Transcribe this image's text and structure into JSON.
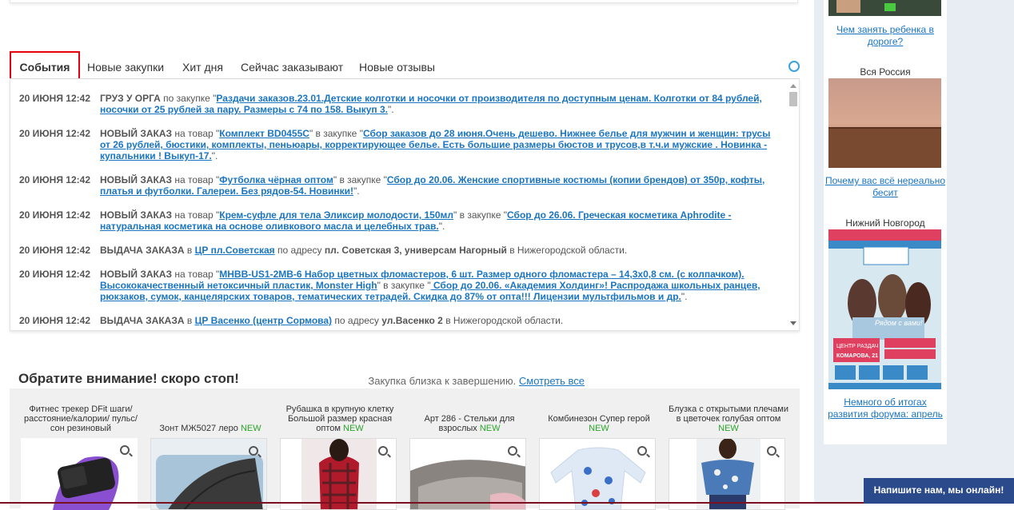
{
  "tabs": {
    "items": [
      "События",
      "Новые закупки",
      "Хит дня",
      "Сейчас заказывают",
      "Новые отзывы"
    ]
  },
  "events": [
    {
      "time": "20 ИЮНЯ 12:42",
      "type": "ГРУЗ У ОРГА",
      "text1": " по закупке \"",
      "link1": "Раздачи заказов.23.01.Детские колготки и носочки от производителя по доступным ценам. Колготки от 84 рублей, носочки от 25 рублей за пару. Размеры с 74 по 158. Выкуп 3.",
      "text2": "\"."
    },
    {
      "time": "20 ИЮНЯ 12:42",
      "type": "НОВЫЙ ЗАКАЗ",
      "text1": " на товар \"",
      "link1": "Комплект BD0455С",
      "text2": "\" в закупке \"",
      "link2": "Сбор заказов до 28 июня.Очень дешево. Нижнее белье для мужчин и женщин: трусы от 26 рублей, бюстики, комплекты, пеньюары, корректирующее белье. Есть большие размеры бюстов и трусов,в т.ч.и мужские . Новинка - купальники ! Выкуп-17.",
      "text3": "\"."
    },
    {
      "time": "20 ИЮНЯ 12:42",
      "type": "НОВЫЙ ЗАКАЗ",
      "text1": " на товар \"",
      "link1": "Футболка чёрная оптом",
      "text2": "\" в закупке \"",
      "link2": "Сбор до 20.06. Женские спортивные костюмы (копии брендов) от 350р, кофты, платья и футболки. Галереи. Без рядов-54. Новинки!",
      "text3": "\"."
    },
    {
      "time": "20 ИЮНЯ 12:42",
      "type": "НОВЫЙ ЗАКАЗ",
      "text1": " на товар \"",
      "link1": "Крем-суфле для тела Эликсир молодости, 150мл",
      "text2": "\" в закупке \"",
      "link2": "Сбор до 26.06. Греческая косметика Aphrodite - натуральная косметика на основе оливкового масла и целебных трав.",
      "text3": "\"."
    },
    {
      "time": "20 ИЮНЯ 12:42",
      "type": "ВЫДАЧА ЗАКАЗА",
      "text1": " в ",
      "link1": "ЦР пл.Советская",
      "text2": " по адресу ",
      "addr": "пл. Советская 3, универсам Нагорный",
      "text3": " в Нижегородской области."
    },
    {
      "time": "20 ИЮНЯ 12:42",
      "type": "НОВЫЙ ЗАКАЗ",
      "text1": " на товар \"",
      "link1": "МНВВ-US1-2MB-6 Набор цветных фломастеров, 6 шт. Размер одного фломастера – 14,3х0,8 см. (с колпачком). Высококачественный нетоксичный пластик, Monster High",
      "text2": "\" в закупке \"",
      "link2": " Сбор до 20.06. «Академия Холдинг»! Распродажа школьных ранцев, рюкзаков, сумок, канцелярских товаров, тематических тетрадей. Скидка до 87% от опта!!! Лицензии мультфильмов и др.",
      "text3": "\"."
    },
    {
      "time": "20 ИЮНЯ 12:42",
      "type": "ВЫДАЧА ЗАКАЗА",
      "text1": " в ",
      "link1": "ЦР Васенко (центр Сормова)",
      "text2": " по адресу ",
      "addr": "ул.Васенко 2",
      "text3": " в Нижегородской области."
    }
  ],
  "stop": {
    "title": "Обратите внимание! скоро стоп!",
    "note": "Закупка близка к завершению. ",
    "see_all": "Смотреть все"
  },
  "products": [
    {
      "name": "Фитнес трекер DFit шаги/ расстояние/калории/ пульс/сон резиновый",
      "new": ""
    },
    {
      "name": "Зонт МЖ5027 леро ",
      "new": "NEW"
    },
    {
      "name": "Рубашка в крупную клетку Большой размер красная оптом ",
      "new": "NEW"
    },
    {
      "name": "Арт 286 - Стельки для взрослых ",
      "new": "NEW"
    },
    {
      "name": "Комбинезон Супер герой ",
      "new": "NEW"
    },
    {
      "name": "Блузка с открытыми плечами в цветочек голубая оптом ",
      "new": "NEW"
    }
  ],
  "sidebar": {
    "top_link": "Чем занять ребенка в дороге?",
    "item2_caption": "Вся Россия",
    "item2_link": "Почему вас всё нереально бесит",
    "item3_caption": "Нижний Новгород",
    "item3_link": "Немного об итогах развития форума: апрель",
    "banner_text": "Рядом с вами!",
    "banner_center": "ЦЕНТР РАЗДАЧ",
    "banner_address": "КОМАРОВА, 21"
  },
  "chat": {
    "label": "Напишите нам, мы онлайн!"
  },
  "colors": {
    "accent": "#1a75c2",
    "tab_highlight": "#e8000f",
    "new_badge": "#2aa52a",
    "chat_bg": "#2b4a8c"
  }
}
